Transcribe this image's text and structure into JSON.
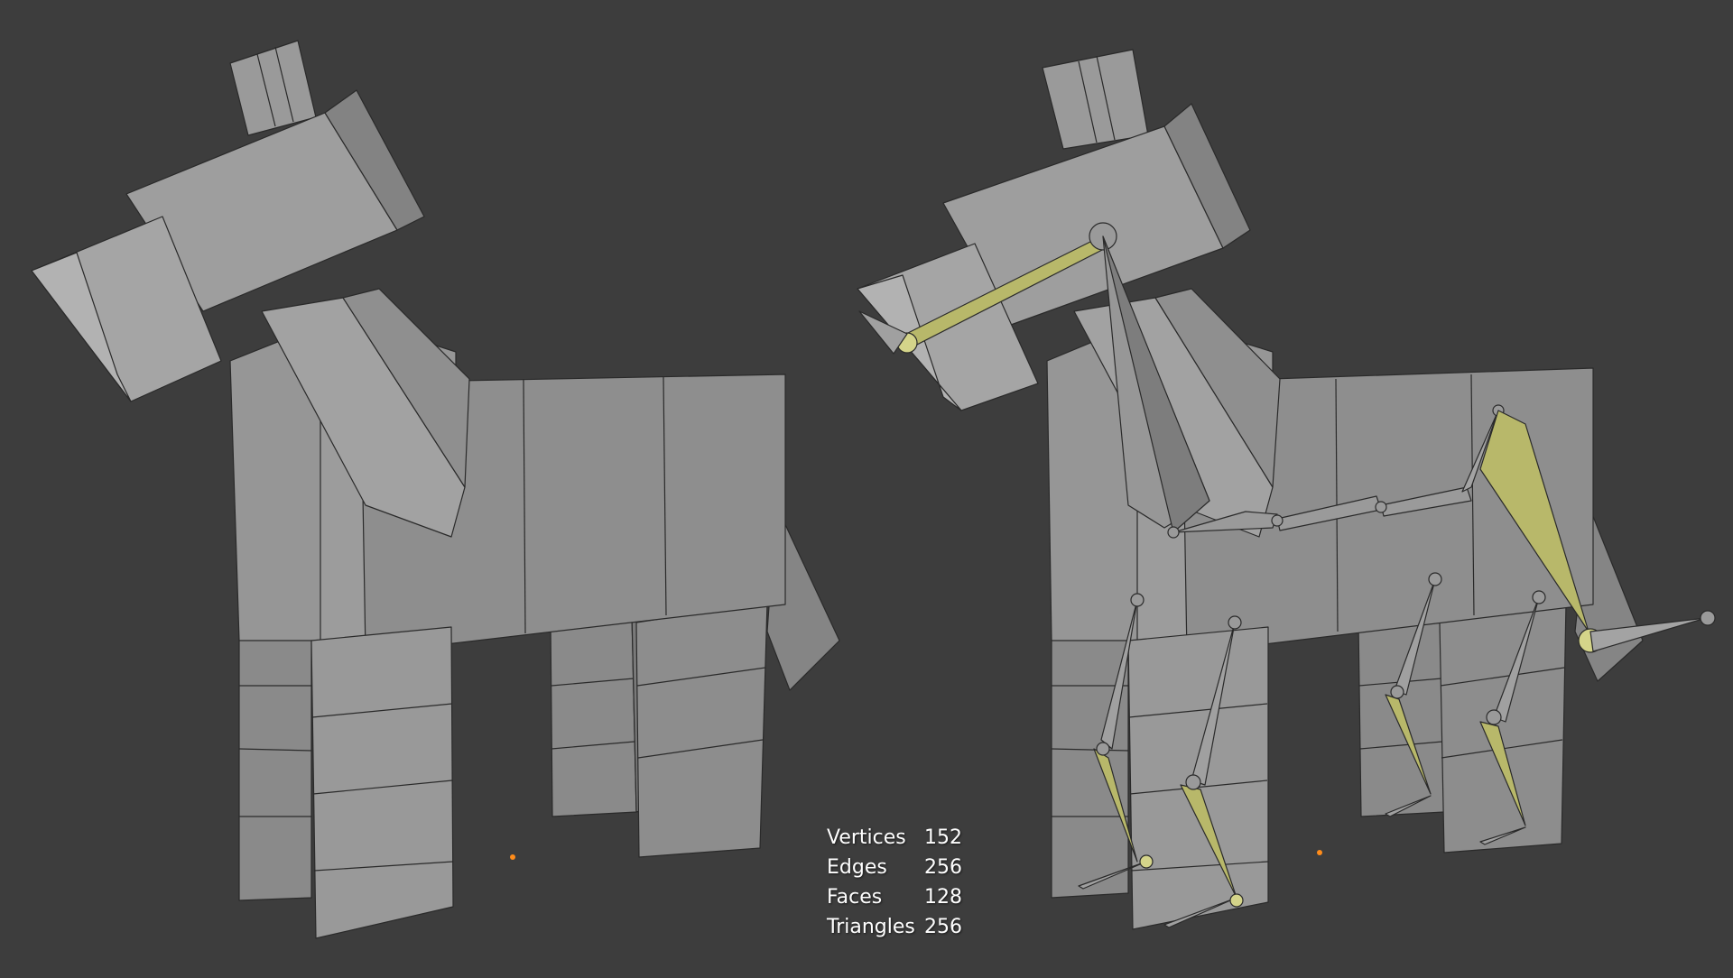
{
  "viewport": {
    "background": "#3d3d3d",
    "mesh_color": "#8e8e8e",
    "bone_color": "#b8b86a",
    "origin_color": "#ff8c1a"
  },
  "stats": [
    {
      "label": "Vertices",
      "value": "152"
    },
    {
      "label": "Edges",
      "value": "256"
    },
    {
      "label": "Faces",
      "value": "128"
    },
    {
      "label": "Triangles",
      "value": "256"
    }
  ]
}
